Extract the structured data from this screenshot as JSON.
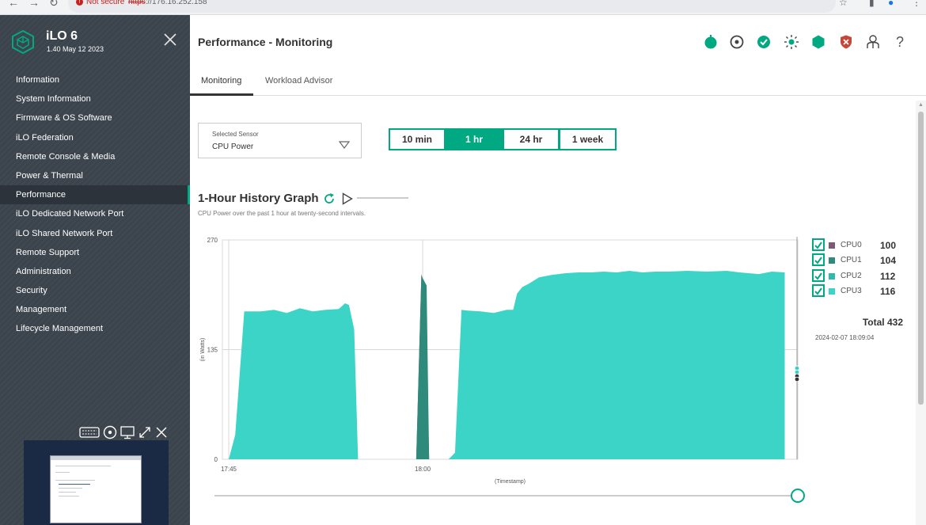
{
  "browser": {
    "security_label": "Not secure",
    "url_scheme": "https",
    "url_rest": "://176.16.252.158"
  },
  "sidebar": {
    "title": "iLO 6",
    "version": "1.40 May 12 2023",
    "items": [
      {
        "label": "Information",
        "active": false
      },
      {
        "label": "System Information",
        "active": false
      },
      {
        "label": "Firmware & OS Software",
        "active": false
      },
      {
        "label": "iLO Federation",
        "active": false
      },
      {
        "label": "Remote Console & Media",
        "active": false
      },
      {
        "label": "Power & Thermal",
        "active": false
      },
      {
        "label": "Performance",
        "active": true
      },
      {
        "label": "iLO Dedicated Network Port",
        "active": false
      },
      {
        "label": "iLO Shared Network Port",
        "active": false
      },
      {
        "label": "Remote Support",
        "active": false
      },
      {
        "label": "Administration",
        "active": false
      },
      {
        "label": "Security",
        "active": false
      },
      {
        "label": "Management",
        "active": false
      },
      {
        "label": "Lifecycle Management",
        "active": false
      }
    ]
  },
  "header": {
    "title": "Performance - Monitoring",
    "icons": [
      "power-icon",
      "uid-icon",
      "health-ok-icon",
      "brightness-icon",
      "hexagon-status-icon",
      "security-shield-icon",
      "user-icon",
      "help-icon"
    ]
  },
  "tabs": [
    {
      "label": "Monitoring",
      "active": true
    },
    {
      "label": "Workload Advisor",
      "active": false
    }
  ],
  "sensor": {
    "label": "Selected Sensor",
    "value": "CPU Power"
  },
  "ranges": [
    {
      "label": "10 min",
      "active": false
    },
    {
      "label": "1 hr",
      "active": true
    },
    {
      "label": "24 hr",
      "active": false
    },
    {
      "label": "1 week",
      "active": false
    }
  ],
  "graph": {
    "title": "1-Hour History Graph",
    "subtitle": "CPU Power over the past 1 hour at twenty-second intervals."
  },
  "legend": {
    "items": [
      {
        "name": "CPU0",
        "value": "100",
        "color": "#7b5a75"
      },
      {
        "name": "CPU1",
        "value": "104",
        "color": "#2e8a7a"
      },
      {
        "name": "CPU2",
        "value": "112",
        "color": "#2fb9a8"
      },
      {
        "name": "CPU3",
        "value": "116",
        "color": "#3dd4c8"
      }
    ],
    "total_label": "Total",
    "total_value": "432",
    "timestamp": "2024-02-07 18:09:04"
  },
  "colors": {
    "accent": "#01a982",
    "sidebar_bg": "#3b444c",
    "area_fill": "#36d1c4"
  },
  "chart_data": {
    "type": "area",
    "ylabel": "(in Watts)",
    "xlabel": "(Timestamp)",
    "ylim": [
      0,
      270
    ],
    "yticks": [
      "0",
      "135",
      "270"
    ],
    "xticks": [
      {
        "label": "17:45",
        "minute": 0
      },
      {
        "label": "18:00",
        "minute": 15
      }
    ],
    "x_unit": "minutes after 17:45",
    "series": [
      {
        "name": "CPU0",
        "points": [
          [
            15.0,
            0
          ],
          [
            15.4,
            228
          ],
          [
            15.7,
            210
          ],
          [
            16.0,
            0
          ]
        ]
      },
      {
        "name": "CPU1",
        "points": [
          [
            15.0,
            0
          ],
          [
            15.4,
            226
          ],
          [
            15.8,
            214
          ],
          [
            16.0,
            0
          ]
        ]
      },
      {
        "name": "CPU3",
        "points": [
          [
            0,
            0
          ],
          [
            0.5,
            0
          ],
          [
            1.0,
            30
          ],
          [
            1.7,
            182
          ],
          [
            3.0,
            182
          ],
          [
            4.0,
            184
          ],
          [
            5.0,
            180
          ],
          [
            6.0,
            186
          ],
          [
            7.0,
            182
          ],
          [
            8.0,
            184
          ],
          [
            9.0,
            185
          ],
          [
            9.5,
            192
          ],
          [
            9.8,
            190
          ],
          [
            10.2,
            160
          ],
          [
            10.5,
            0
          ],
          [
            13.0,
            0
          ],
          [
            17.5,
            0
          ],
          [
            18.0,
            8
          ],
          [
            18.5,
            184
          ],
          [
            19.0,
            183
          ],
          [
            20.0,
            182
          ],
          [
            21.0,
            180
          ],
          [
            22.0,
            184
          ],
          [
            22.5,
            184
          ],
          [
            22.8,
            204
          ],
          [
            23.2,
            212
          ],
          [
            23.7,
            216
          ],
          [
            24.5,
            224
          ],
          [
            25.5,
            227
          ],
          [
            26.5,
            229
          ],
          [
            27.5,
            230
          ],
          [
            28.5,
            230
          ],
          [
            29.5,
            231
          ],
          [
            30.5,
            230
          ],
          [
            31.5,
            232
          ],
          [
            32.5,
            230
          ],
          [
            33.5,
            231
          ],
          [
            34.5,
            231
          ],
          [
            36.0,
            232
          ],
          [
            37.5,
            231
          ],
          [
            39.0,
            232
          ],
          [
            40.0,
            230
          ],
          [
            41.5,
            228
          ],
          [
            42.5,
            231
          ],
          [
            43.5,
            230
          ]
        ]
      }
    ]
  }
}
